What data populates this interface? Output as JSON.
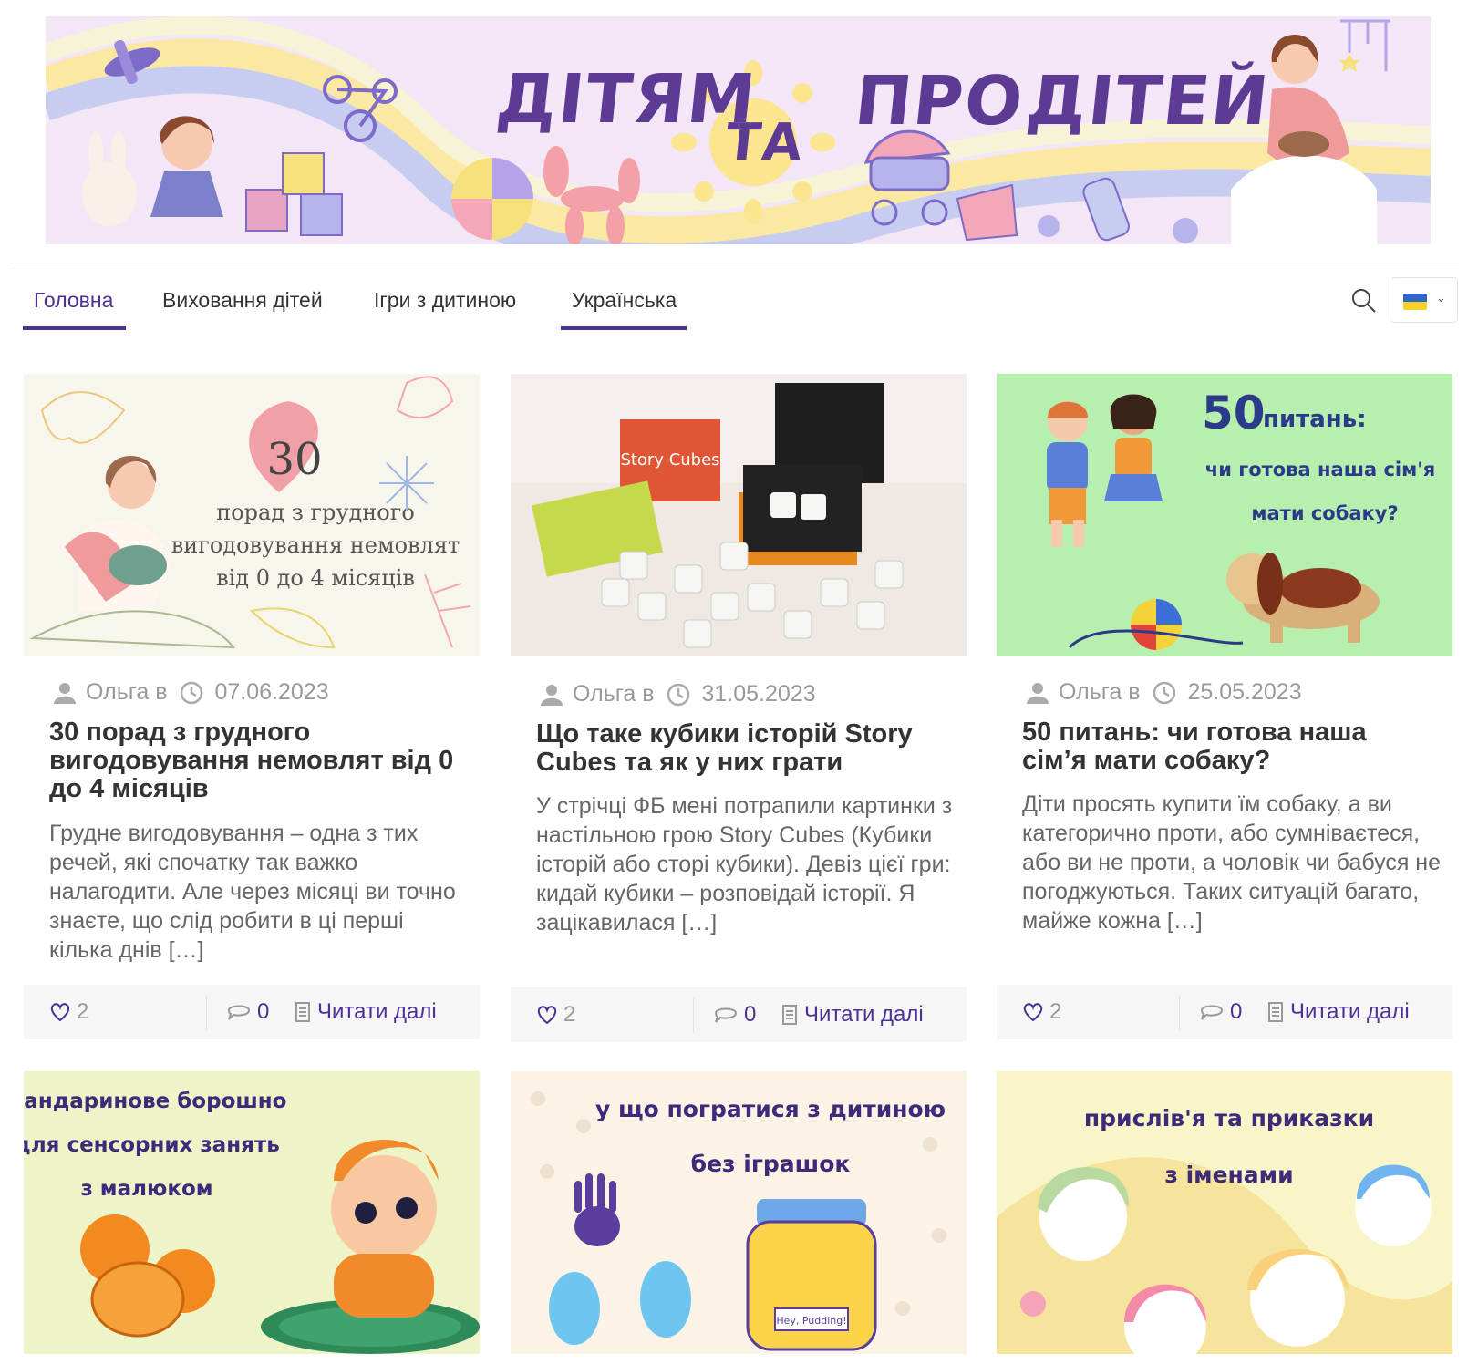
{
  "banner": {
    "word1": "ДІТЯМ",
    "word2": "ТА",
    "word3": "ПРО",
    "word4": "ДІТЕЙ"
  },
  "nav": {
    "items": [
      {
        "label": "Головна"
      },
      {
        "label": "Виховання дітей"
      },
      {
        "label": "Ігри з дитиною"
      },
      {
        "label": "Українська"
      }
    ],
    "search_icon": "search-icon",
    "language_flag": "ukraine-flag-icon"
  },
  "colors": {
    "accent": "#4c3192",
    "meta_gray": "#9a9a9a",
    "footer_bg": "#f6f6f6"
  },
  "posts": [
    {
      "image_text": {
        "number": "30",
        "line1": "порад з грудного",
        "line2": "вигодовування немовлят",
        "line3": "від 0 до 4 місяців"
      },
      "author": "Ольга в",
      "date": "07.06.2023",
      "title": "30 порад з грудного вигодовування немовлят від 0 до 4 місяців",
      "excerpt": "Грудне вигодовування – одна з тих речей, які спочатку так важко налагодити. Але через місяці ви точно знаєте, що слід робити в ці перші кілька днів […]",
      "likes": "2",
      "comments": "0",
      "read_more": "Читати далі"
    },
    {
      "image_text": {
        "box": "Story Cubes"
      },
      "author": "Ольга в",
      "date": "31.05.2023",
      "title": "Що таке кубики історій Story Cubes та як у них грати",
      "excerpt": "У стрічці ФБ мені потрапили картинки з настільною грою Story Cubes (Кубики історій або сторі кубики). Девіз цієї гри: кидай кубики – розповідай історії. Я зацікавилася […]",
      "likes": "2",
      "comments": "0",
      "read_more": "Читати далі"
    },
    {
      "image_text": {
        "number": "50",
        "line0": "питань:",
        "line1": "чи готова наша сім'я",
        "line2": "мати собаку?"
      },
      "author": "Ольга в",
      "date": "25.05.2023",
      "title": "50 питань: чи готова наша сім’я мати собаку?",
      "excerpt": "Діти просять купити їм собаку, а ви категорично проти, або сумніваєтеся, або ви не проти, а чоловік чи бабуся не погоджуються. Таких ситуацій багато, майже кожна […]",
      "likes": "2",
      "comments": "0",
      "read_more": "Читати далі"
    },
    {
      "image_text": {
        "line1": "мандаринове борошно",
        "line2": "для сенсорних занять",
        "line3": "з малюком"
      }
    },
    {
      "image_text": {
        "line1": "у що погратися з дитиною",
        "line2": "без іграшок",
        "jar": "Hey, Pudding!"
      }
    },
    {
      "image_text": {
        "line1": "прислів'я та приказки",
        "line2": "з іменами"
      }
    }
  ]
}
